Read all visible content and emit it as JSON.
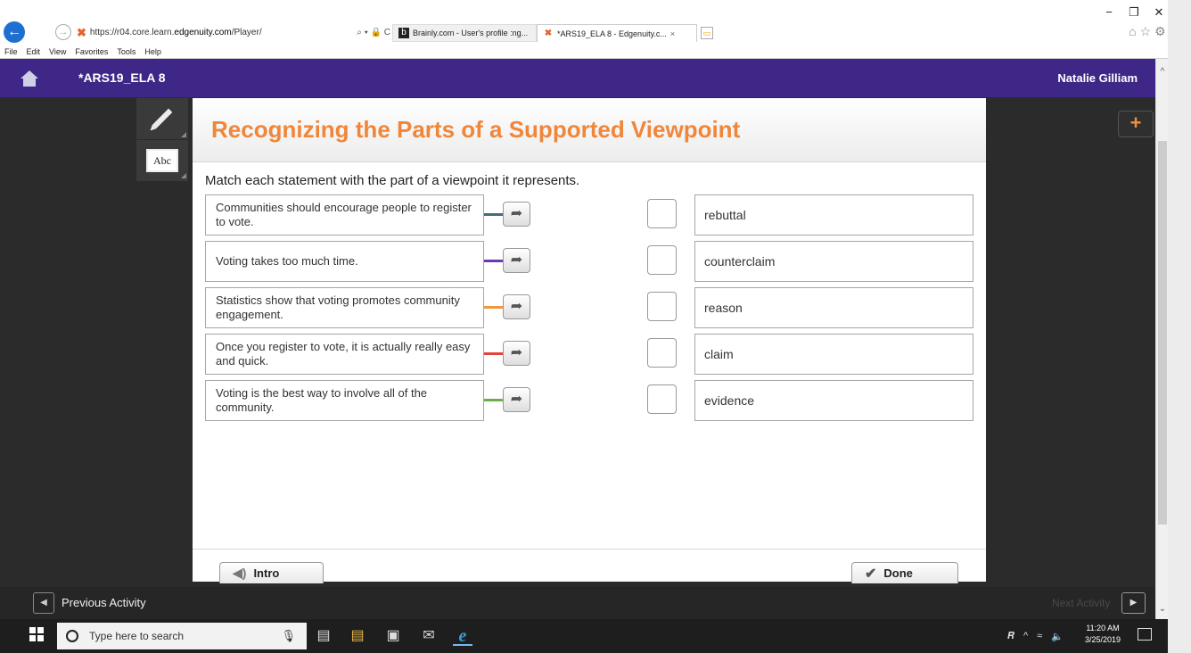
{
  "browser": {
    "url_prefix": "https://r04.core.learn.",
    "url_domain": "edgenuity.com",
    "url_path": "/Player/",
    "address_tools": "⌕ ▾ 🔒 C",
    "tabs": [
      {
        "label": "Brainly.com - User's profile :ng..."
      },
      {
        "label": "*ARS19_ELA 8 - Edgenuity.c...",
        "close": "×"
      }
    ],
    "menu": [
      "File",
      "Edit",
      "View",
      "Favorites",
      "Tools",
      "Help"
    ],
    "window_controls": {
      "minimize": "−",
      "restore": "❐",
      "close": "✕"
    },
    "toolbar_icons": {
      "home": "⌂",
      "favorites": "☆",
      "settings": "⚙",
      "smiley": "☺"
    }
  },
  "app": {
    "course_title": "*ARS19_ELA 8",
    "user_name": "Natalie Gilliam"
  },
  "activity": {
    "title": "Recognizing the Parts of a Supported Viewpoint",
    "instruction": "Match each statement with the part of a viewpoint it represents.",
    "statements": [
      {
        "text": "Communities should encourage people to register to vote.",
        "color": "#3f6e7a"
      },
      {
        "text": "Voting takes too much time.",
        "color": "#6a3ab0"
      },
      {
        "text": "Statistics show that voting promotes community engagement.",
        "color": "#f0963c"
      },
      {
        "text": "Once you register to vote, it is actually really easy and quick.",
        "color": "#e0443a"
      },
      {
        "text": "Voting is the best way to involve all of the community.",
        "color": "#6ab04a"
      }
    ],
    "answers": [
      "rebuttal",
      "counterclaim",
      "reason",
      "claim",
      "evidence"
    ],
    "intro_label": "Intro",
    "done_label": "Done"
  },
  "nav": {
    "previous_label": "Previous Activity",
    "next_label": "Next Activity"
  },
  "taskbar": {
    "search_placeholder": "Type here to search",
    "time": "11:20 AM",
    "date": "3/25/2019"
  }
}
